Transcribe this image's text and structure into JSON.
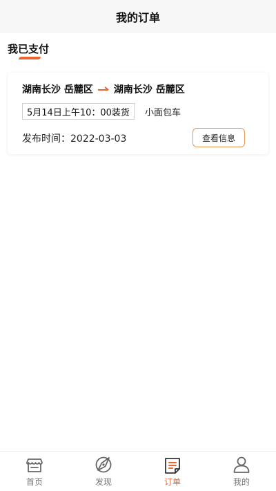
{
  "header": {
    "title": "我的订单"
  },
  "section": {
    "tab_label": "我已支付"
  },
  "order": {
    "origin": "湖南长沙 岳麓区",
    "destination": "湖南长沙 岳麓区",
    "loading_time": "5月14日上午10：00装货",
    "vehicle": "小面包车",
    "publish_time": "发布时间：2022-03-03",
    "view_button": "查看信息"
  },
  "tabbar": {
    "items": [
      {
        "label": "首页",
        "icon": "store-icon",
        "active": false
      },
      {
        "label": "发现",
        "icon": "compass-icon",
        "active": false
      },
      {
        "label": "订单",
        "icon": "order-list-icon",
        "active": true
      },
      {
        "label": "我的",
        "icon": "user-icon",
        "active": false
      }
    ]
  },
  "colors": {
    "accent": "#e8652e",
    "inactive": "#777777",
    "header_bg": "#f7f7f7"
  }
}
